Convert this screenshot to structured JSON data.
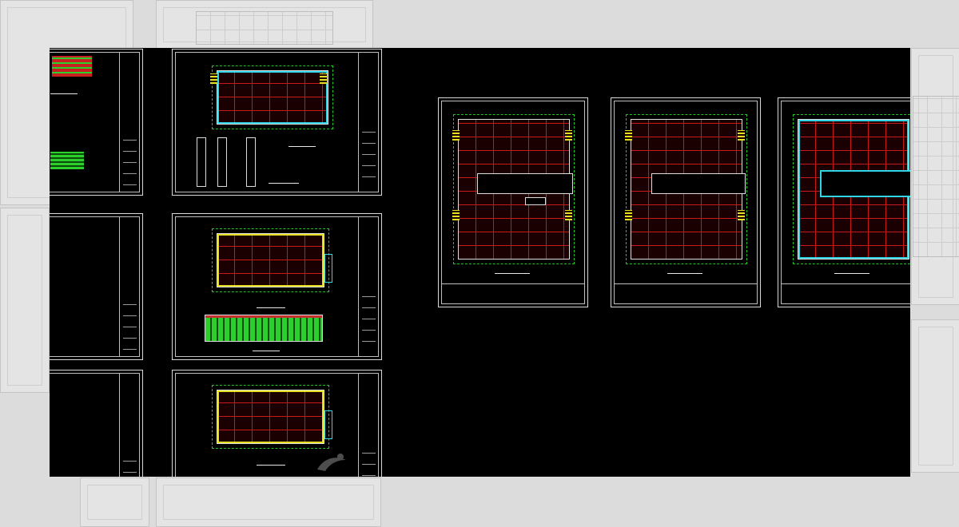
{
  "canvas": {
    "background": "#000000",
    "accent_colors": {
      "grid": "#c81818",
      "dimension": "#25c425",
      "wall": "#31d6e6",
      "stair": "#e5e021",
      "sheet_border": "#d9d9d9"
    }
  },
  "sheets": [
    {
      "name": "sheet-left-top"
    },
    {
      "name": "sheet-left-middle"
    },
    {
      "name": "sheet-left-bottom"
    },
    {
      "name": "sheet-column2-top"
    },
    {
      "name": "sheet-column2-middle"
    },
    {
      "name": "sheet-column2-bottom"
    },
    {
      "name": "sheet-plan-first-floor"
    },
    {
      "name": "sheet-plan-second-third-floor"
    },
    {
      "name": "sheet-plan-roof"
    }
  ],
  "icons": {
    "watermark": "brand-watermark-icon"
  }
}
